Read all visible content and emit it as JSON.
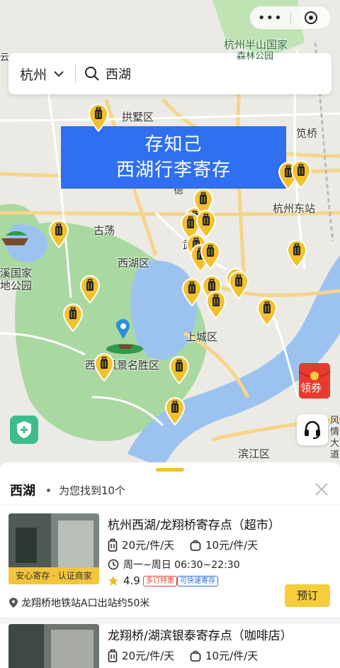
{
  "search": {
    "city": "杭州",
    "query": "西湖"
  },
  "banner": {
    "line1": "存知己",
    "line2": "西湖行李寄存"
  },
  "map_labels": {
    "hangzhou_banshan": "杭州半山国家",
    "banshan_sub": "森林公园",
    "gongshu": "拱墅区",
    "jianqiao": "笕桥",
    "dongzhan": "杭州东站",
    "gudang": "古荡",
    "xihu_district": "西湖区",
    "xixi_line1": "溪国家",
    "xixi_line2": "地公园",
    "shangcheng": "上城区",
    "scenic": "西湖风景名胜区",
    "binjiang": "滨江区",
    "wulin": "武",
    "de": "德",
    "tai_left": "云",
    "right_edge": "风情大道"
  },
  "results": {
    "location": "西湖",
    "count_text": "为您找到10个"
  },
  "listings": [
    {
      "title": "杭州西湖/龙翔桥寄存点（超市）",
      "ribbon": "安心寄存 · 认证商家",
      "price_large": "20元/件/天",
      "price_small": "10元/件/天",
      "hours": "周一~周日 06:30~22:30",
      "rating": "4.9",
      "tags": [
        "多订特惠",
        "可快速寄存"
      ],
      "address": "龙翔桥地铁站A口出站约50米",
      "book_label": "预订"
    },
    {
      "title": "龙翔桥/湖滨银泰寄存点（咖啡店）",
      "price_large": "20元/件/天",
      "price_small": "10元/件/天"
    }
  ],
  "icons": {
    "more": "more-dots-icon",
    "close_capsule": "capsule-close-icon",
    "search": "search-icon",
    "chevron": "chevron-down-icon",
    "pin": "luggage-pin-icon",
    "shield": "shield-plus-icon",
    "headset": "headset-icon",
    "coupon": "coupon-envelope-icon",
    "close_sheet": "close-icon"
  },
  "coupon_label": "领券",
  "colors": {
    "accent": "#f5cd3d",
    "banner": "#2f6ff0",
    "pin": "#f2c12e",
    "water": "#9cc3ef",
    "park": "#a9d8a0"
  }
}
